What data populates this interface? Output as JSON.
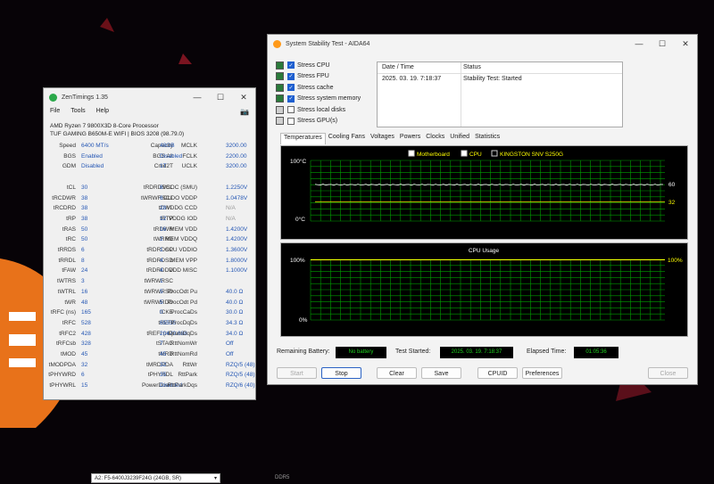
{
  "colors": {
    "blue_val": "#2456b4",
    "graph_green": "#00a000",
    "temp_line": "#ffffff",
    "yellow": "#ffff00"
  },
  "zen": {
    "title": "ZenTimings 1.35",
    "menu": [
      "File",
      "Tools",
      "Help"
    ],
    "cpu": "AMD Ryzen 7 9800X3D 8-Core Processor",
    "board": "TUF GAMING B650M-E WIFI | BIOS 3208 (98.79.0)",
    "rows": [
      [
        "Speed",
        "6400 MT/s",
        "b",
        "Capacity",
        "48GB",
        "b",
        "MCLK",
        "3200.00",
        "b"
      ],
      [
        "BGS",
        "Enabled",
        "b",
        "BGS Alt",
        "Disabled",
        "b",
        "FCLK",
        "2200.00",
        "b"
      ],
      [
        "GDM",
        "Disabled",
        "b",
        "Cmd2T",
        "1T",
        "b",
        "UCLK",
        "3200.00",
        "b"
      ],
      [
        "",
        "",
        "",
        "",
        "",
        "",
        "",
        "",
        ""
      ],
      [
        "tCL",
        "30",
        "b",
        "tRDRDSCL",
        "6",
        "b",
        "VSOC (SMU)",
        "1.2250V",
        "b"
      ],
      [
        "tRCDWR",
        "38",
        "b",
        "tWRWRSCL",
        "6",
        "b",
        "CLDO VDDP",
        "1.0478V",
        "b"
      ],
      [
        "tRCDRD",
        "38",
        "b",
        "tCWL",
        "28",
        "b",
        "VDDG CCD",
        "N/A",
        "g"
      ],
      [
        "tRP",
        "38",
        "b",
        "tRTP",
        "12",
        "b",
        "VDDG IOD",
        "N/A",
        "g"
      ],
      [
        "tRAS",
        "50",
        "b",
        "tRDWR",
        "16",
        "b",
        "MEM VDD",
        "1.4200V",
        "b"
      ],
      [
        "tRC",
        "50",
        "b",
        "tWRRD",
        "2",
        "b",
        "MEM VDDQ",
        "1.4200V",
        "b"
      ],
      [
        "tRRDS",
        "6",
        "b",
        "tRDRDSC",
        "1",
        "b",
        "CPU VDDIO",
        "1.3600V",
        "b"
      ],
      [
        "tRRDL",
        "8",
        "b",
        "tRDRDSD",
        "4",
        "b",
        "MEM VPP",
        "1.8000V",
        "b"
      ],
      [
        "tFAW",
        "24",
        "b",
        "tRDRDDD",
        "4",
        "b",
        "VDD MISC",
        "1.1000V",
        "b"
      ],
      [
        "tWTRS",
        "3",
        "b",
        "tWRWRSC",
        "1",
        "b",
        "",
        "",
        ""
      ],
      [
        "tWTRL",
        "16",
        "b",
        "tWRWRSD",
        "5",
        "b",
        "ProcOdt Pu",
        "40.0 Ω",
        "b"
      ],
      [
        "tWR",
        "48",
        "b",
        "tWRWRDD",
        "5",
        "b",
        "ProcOdt Pd",
        "40.0 Ω",
        "b"
      ],
      [
        "tRFC (ns)",
        "165",
        "b",
        "tCKE",
        "0",
        "b",
        "ProcCaDs",
        "30.0 Ω",
        "b"
      ],
      [
        "tRFC",
        "528",
        "b",
        "tREFI",
        "65535",
        "b",
        "ProcDqDs",
        "34.3 Ω",
        "b"
      ],
      [
        "tRFC2",
        "428",
        "b",
        "tREFI (ns)",
        "20479.688",
        "b",
        "DramDqDs",
        "34.0 Ω",
        "b"
      ],
      [
        "tRFCsb",
        "328",
        "b",
        "tSTAG",
        "7",
        "b",
        "RttNomWr",
        "Off",
        "b"
      ],
      [
        "tMOD",
        "45",
        "b",
        "tMRD",
        "45",
        "b",
        "RttNomRd",
        "Off",
        "b"
      ],
      [
        "tMODPDA",
        "32",
        "b",
        "tMRDPDA",
        "32",
        "b",
        "RttWr",
        "RZQ/5 (48)",
        "b"
      ],
      [
        "tPHYWRD",
        "6",
        "b",
        "tPHYRDL",
        "35",
        "b",
        "RttPark",
        "RZQ/5 (48)",
        "b"
      ],
      [
        "tPHYWRL",
        "15",
        "b",
        "PowerDown",
        "Disabled",
        "b",
        "RttParkDqs",
        "RZQ/6 (40)",
        "b"
      ]
    ],
    "module": "A2: F5-6400J3239F24G (24GB, SR)",
    "ddr": "DDR5"
  },
  "aida": {
    "title": "System Stability Test - AIDA64",
    "stress": [
      {
        "label": "Stress CPU",
        "on": true
      },
      {
        "label": "Stress FPU",
        "on": true
      },
      {
        "label": "Stress cache",
        "on": true
      },
      {
        "label": "Stress system memory",
        "on": true
      },
      {
        "label": "Stress local disks",
        "on": false
      },
      {
        "label": "Stress GPU(s)",
        "on": false
      }
    ],
    "log_headers": [
      "Date / Time",
      "Status"
    ],
    "log_row": [
      "2025. 03. 19. 7:18:37",
      "Stability Test: Started"
    ],
    "tabs": [
      "Temperatures",
      "Cooling Fans",
      "Voltages",
      "Powers",
      "Clocks",
      "Unified",
      "Statistics"
    ],
    "legend": [
      "Motherboard",
      "CPU",
      "KINGSTON SNV S250G"
    ],
    "temp_top": "100°C",
    "temp_bottom": "0°C",
    "temp_val_a": "60",
    "temp_val_b": "32",
    "cpu_title": "CPU Usage",
    "cpu_top": "100%",
    "cpu_bottom": "0%",
    "cpu_val": "100%",
    "remaining_label": "Remaining Battery:",
    "remaining_val": "No battery",
    "started_label": "Test Started:",
    "started_val": "2025. 03. 19. 7:18:37",
    "elapsed_label": "Elapsed Time:",
    "elapsed_val": "01:05:36",
    "buttons": [
      "Start",
      "Stop",
      "Clear",
      "Save",
      "CPUID",
      "Preferences",
      "Close"
    ]
  }
}
